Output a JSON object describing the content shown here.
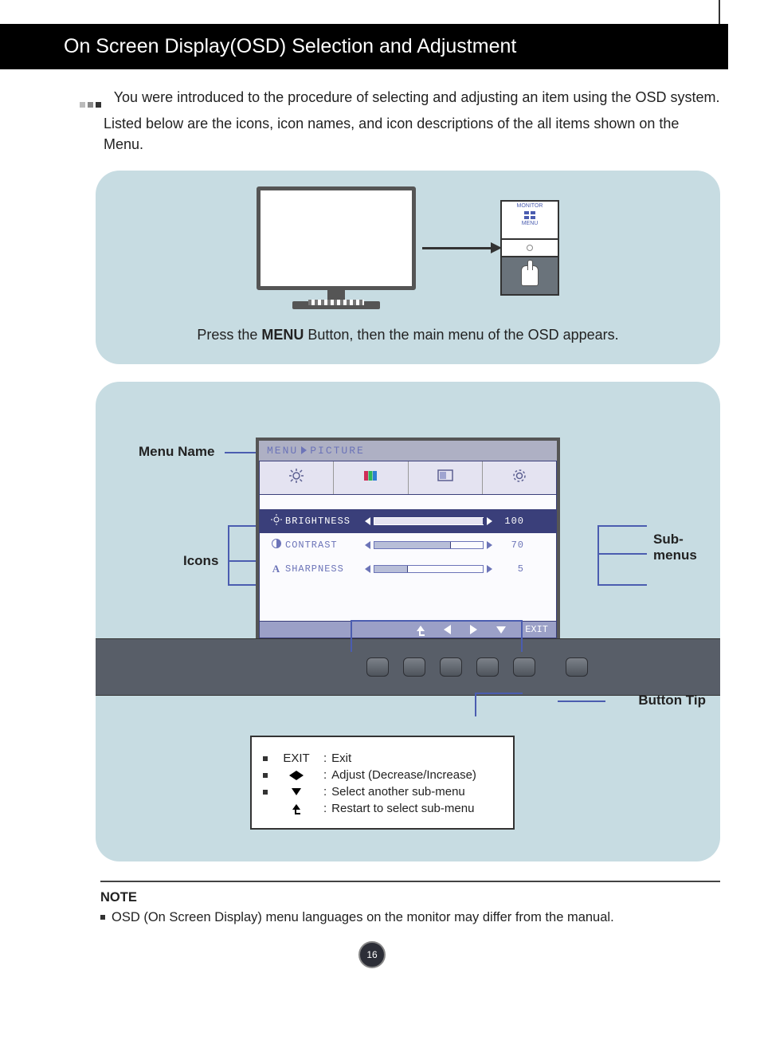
{
  "page_number": "16",
  "title": "On Screen Display(OSD) Selection and Adjustment",
  "intro": "You were introduced to the procedure of selecting and adjusting an item using the OSD system. Listed below are the icons, icon names, and icon descriptions of the all items shown on the Menu.",
  "panel1": {
    "zoom_label_top": "MONITOR",
    "zoom_label_menu": "MENU",
    "caption_pre": "Press the ",
    "caption_bold": "MENU",
    "caption_post": " Button, then the main menu of the OSD appears."
  },
  "labels": {
    "menu_name": "Menu Name",
    "icons": "Icons",
    "submenus": "Sub-menus",
    "button_tip": "Button Tip"
  },
  "osd": {
    "breadcrumb_root": "MENU",
    "breadcrumb_leaf": "PICTURE",
    "tabs_icons": [
      "brightness-icon",
      "color-icon",
      "screen-icon",
      "settings-icon"
    ],
    "rows": [
      {
        "icon": "sun-icon",
        "name": "BRIGHTNESS",
        "value": "100",
        "fill_pct": 100,
        "selected": true
      },
      {
        "icon": "contrast-icon",
        "name": "CONTRAST",
        "value": "70",
        "fill_pct": 70,
        "selected": false
      },
      {
        "icon": "sharpness-icon",
        "name": "SHARPNESS",
        "value": "5",
        "fill_pct": 30,
        "selected": false
      }
    ],
    "footer_exit": "EXIT"
  },
  "legend": {
    "items": [
      {
        "key": "EXIT",
        "type": "text",
        "desc": "Exit"
      },
      {
        "key": "left-right",
        "type": "lr",
        "desc": "Adjust (Decrease/Increase)"
      },
      {
        "key": "down",
        "type": "down",
        "desc": "Select another sub-menu"
      },
      {
        "key": "return",
        "type": "return",
        "desc": "Restart to select sub-menu"
      }
    ]
  },
  "note": {
    "label": "NOTE",
    "text": "OSD (On Screen Display) menu languages on the monitor may differ from the manual."
  }
}
